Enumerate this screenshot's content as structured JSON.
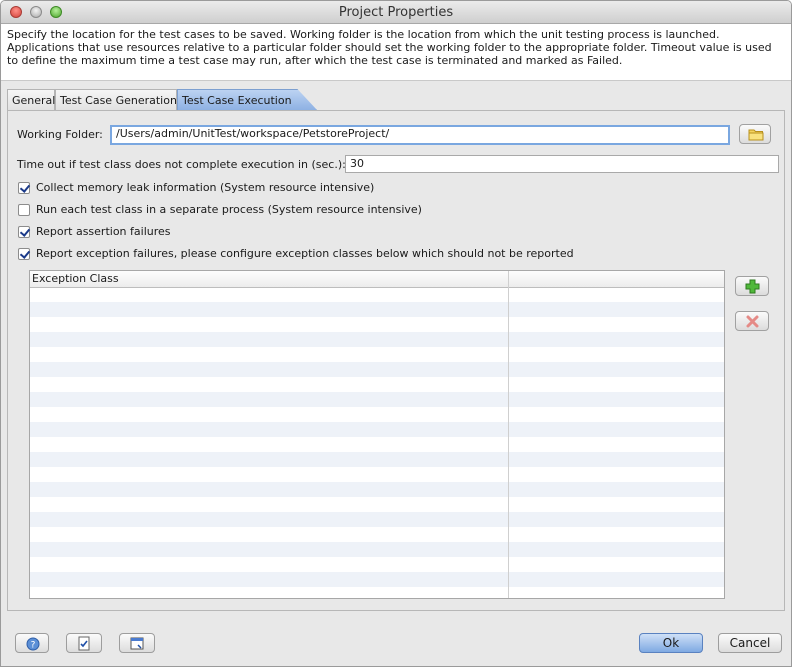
{
  "window": {
    "title": "Project Properties"
  },
  "description": "Specify the location for the test cases to be saved. Working folder is the location from which the unit testing process is launched. Applications that use resources relative to a particular folder should set the working folder to the appropriate folder. Timeout value is used to define the maximum time a test case may run, after which the test case is terminated and marked as Failed.",
  "tabs": [
    {
      "label": "General"
    },
    {
      "label": "Test Case Generation"
    },
    {
      "label": "Test Case Execution",
      "selected": true
    }
  ],
  "form": {
    "working_folder_label": "Working Folder:",
    "working_folder_value": "/Users/admin/UnitTest/workspace/PetstoreProject/",
    "timeout_label": "Time out if test class does not complete execution in (sec.):",
    "timeout_value": "30",
    "checks": [
      {
        "label": "Collect memory leak information (System resource intensive)",
        "checked": true
      },
      {
        "label": "Run each test class in a separate process (System resource intensive)",
        "checked": false
      },
      {
        "label": "Report assertion failures",
        "checked": true
      },
      {
        "label": "Report exception failures, please configure exception classes below which should not be reported",
        "checked": true
      }
    ]
  },
  "table": {
    "columns": [
      "Exception Class",
      ""
    ],
    "rows": []
  },
  "icons": {
    "folder": "folder-icon",
    "add": "plus-icon",
    "remove": "x-icon",
    "help": "help-icon",
    "checklist": "checklist-icon",
    "window": "window-icon"
  },
  "buttons": {
    "ok": "Ok",
    "cancel": "Cancel"
  },
  "colors": {
    "selected_tab": "#9bbbe8",
    "accent": "#7aa7e0",
    "row_alt": "#eef2f8"
  }
}
